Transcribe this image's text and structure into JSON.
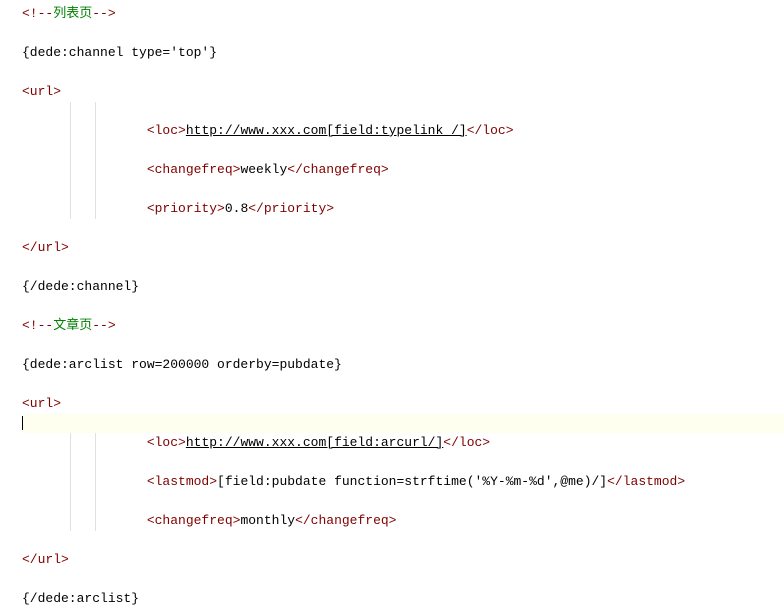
{
  "lines": [
    {
      "indent": 0,
      "segs": [
        {
          "cls": "tag",
          "t": "<!--"
        },
        {
          "cls": "comment",
          "t": "列表页"
        },
        {
          "cls": "tag",
          "t": "-->"
        }
      ]
    },
    {
      "blank": true
    },
    {
      "indent": 0,
      "segs": [
        {
          "cls": "txt",
          "t": "{dede:channel type='top'}"
        }
      ]
    },
    {
      "blank": true
    },
    {
      "indent": 0,
      "segs": [
        {
          "cls": "tag",
          "t": "<url>"
        }
      ]
    },
    {
      "blank": true,
      "guides": [
        1,
        2
      ]
    },
    {
      "indent": 2,
      "guides": [
        1,
        2
      ],
      "segs": [
        {
          "cls": "tag",
          "t": "<loc>"
        },
        {
          "cls": "txt underline",
          "t": "http://www.xxx.com[field:typelink /]"
        },
        {
          "cls": "tag",
          "t": "</loc>"
        }
      ]
    },
    {
      "blank": true,
      "guides": [
        1,
        2
      ]
    },
    {
      "indent": 2,
      "guides": [
        1,
        2
      ],
      "segs": [
        {
          "cls": "tag",
          "t": "<changefreq>"
        },
        {
          "cls": "txt",
          "t": "weekly"
        },
        {
          "cls": "tag",
          "t": "</changefreq>"
        }
      ]
    },
    {
      "blank": true,
      "guides": [
        1,
        2
      ]
    },
    {
      "indent": 2,
      "guides": [
        1,
        2
      ],
      "segs": [
        {
          "cls": "tag",
          "t": "<priority>"
        },
        {
          "cls": "txt",
          "t": "0.8"
        },
        {
          "cls": "tag",
          "t": "</priority>"
        }
      ]
    },
    {
      "blank": true
    },
    {
      "indent": 0,
      "segs": [
        {
          "cls": "tag",
          "t": "</url>"
        }
      ]
    },
    {
      "blank": true
    },
    {
      "indent": 0,
      "segs": [
        {
          "cls": "txt",
          "t": "{/dede:channel}"
        }
      ]
    },
    {
      "blank": true
    },
    {
      "indent": 0,
      "segs": [
        {
          "cls": "tag",
          "t": "<!--"
        },
        {
          "cls": "comment",
          "t": "文章页"
        },
        {
          "cls": "tag",
          "t": "-->"
        }
      ]
    },
    {
      "blank": true
    },
    {
      "indent": 0,
      "segs": [
        {
          "cls": "txt",
          "t": "{dede:arclist row=200000 orderby=pubdate}"
        }
      ]
    },
    {
      "blank": true
    },
    {
      "indent": 0,
      "segs": [
        {
          "cls": "tag",
          "t": "<url>"
        }
      ]
    },
    {
      "cursor": true
    },
    {
      "indent": 2,
      "guides": [
        1,
        2
      ],
      "segs": [
        {
          "cls": "tag",
          "t": "<loc>"
        },
        {
          "cls": "txt underline",
          "t": "http://www.xxx.com[field:arcurl/]"
        },
        {
          "cls": "tag",
          "t": "</loc>"
        }
      ]
    },
    {
      "blank": true,
      "guides": [
        1,
        2
      ]
    },
    {
      "indent": 2,
      "guides": [
        1,
        2
      ],
      "segs": [
        {
          "cls": "tag",
          "t": "<lastmod>"
        },
        {
          "cls": "txt",
          "t": "[field:pubdate function=strftime('%Y-%m-%d',@me)/]"
        },
        {
          "cls": "tag",
          "t": "</lastmod>"
        }
      ]
    },
    {
      "blank": true,
      "guides": [
        1,
        2
      ]
    },
    {
      "indent": 2,
      "guides": [
        1,
        2
      ],
      "segs": [
        {
          "cls": "tag",
          "t": "<changefreq>"
        },
        {
          "cls": "txt",
          "t": "monthly"
        },
        {
          "cls": "tag",
          "t": "</changefreq>"
        }
      ]
    },
    {
      "blank": true
    },
    {
      "indent": 0,
      "segs": [
        {
          "cls": "tag",
          "t": "</url>"
        }
      ]
    },
    {
      "blank": true
    },
    {
      "indent": 0,
      "segs": [
        {
          "cls": "txt",
          "t": "{/dede:arclist}"
        }
      ]
    }
  ]
}
